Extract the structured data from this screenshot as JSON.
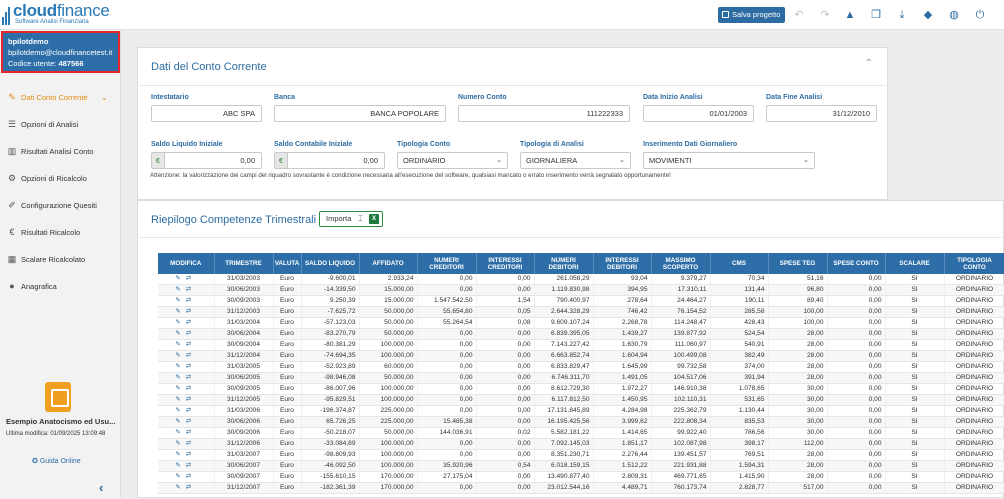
{
  "app": {
    "logo_bold": "cloud",
    "logo_light": "finance",
    "logo_sub": "Software Analisi Finanziaria",
    "save_label": "Salva progetto"
  },
  "toolbar_icons": [
    "undo-icon",
    "redo-icon",
    "warning-icon",
    "copy-icon",
    "download-icon",
    "tags-icon",
    "globe-icon",
    "power-icon"
  ],
  "user": {
    "name": "bpilotdemo",
    "email": "bpilotdemo@cloudfinancetest.it",
    "code_label": "Codice utente:",
    "code_value": "487566"
  },
  "nav": [
    {
      "label": "Dati Conto Corrente",
      "icon": "edit-icon",
      "active": true
    },
    {
      "label": "Opzioni di Analisi",
      "icon": "sliders-icon"
    },
    {
      "label": "Risultati Analisi Conto",
      "icon": "chart-icon"
    },
    {
      "label": "Opzioni di Ricalcolo",
      "icon": "gears-icon"
    },
    {
      "label": "Configurazione Quesiti",
      "icon": "pencil-icon"
    },
    {
      "label": "Risultati Ricalcolo",
      "icon": "euro-icon"
    },
    {
      "label": "Scalare Ricalcolato",
      "icon": "table-icon"
    },
    {
      "label": "Anagrafica",
      "icon": "user-icon"
    }
  ],
  "project": {
    "name": "Esempio Anatocismo ed Usu...",
    "modified": "Ultima modifica: 01/09/2025 13:09:48"
  },
  "guide_label": "Guida Online",
  "account": {
    "title": "Dati del Conto Corrente",
    "intestatario_label": "Intestatario",
    "intestatario_value": "ABC SPA",
    "banca_label": "Banca",
    "banca_value": "BANCA POPOLARE",
    "numero_label": "Numero Conto",
    "numero_value": "111222333",
    "inizio_label": "Data Inizio Analisi",
    "inizio_value": "01/01/2003",
    "fine_label": "Data Fine Analisi",
    "fine_value": "31/12/2010",
    "saldo_liq_label": "Saldo Liquido Iniziale",
    "saldo_liq_value": "0,00",
    "saldo_cont_label": "Saldo Contabile Iniziale",
    "saldo_cont_value": "0,00",
    "currency": "€",
    "tipologia_conto_label": "Tipologia Conto",
    "tipologia_conto_value": "ORDINARIO",
    "tipologia_analisi_label": "Tipologia di Analisi",
    "tipologia_analisi_value": "GIORNALIERA",
    "inserimento_label": "Inserimento Dati Giornaliero",
    "inserimento_value": "MOVIMENTI",
    "note": "Attenzione: la valorizzazione dei campi del riquadro sovrastante è condizione necessaria all'esecuzione del software, qualsiasi mancato o errato inserimento verrà segnalato opportunamente!"
  },
  "summary": {
    "title": "Riepilogo Competenze Trimestrali",
    "import_label": "Importa",
    "columns": [
      "MODIFICA",
      "TRIMESTRE",
      "VALUTA",
      "SALDO LIQUIDO",
      "AFFIDATO",
      "NUMERI CREDITORI",
      "INTERESSI CREDITORI",
      "NUMERI DEBITORI",
      "INTERESSI DEBITORI",
      "MASSIMO SCOPERTO",
      "CMS",
      "SPESE TEG",
      "SPESE CONTO",
      "SCALARE",
      "TIPOLOGIA CONTO"
    ],
    "rows": [
      [
        "31/03/2003",
        "Euro",
        "-9.600,01",
        "2.933,24",
        "0,00",
        "0,00",
        "261.058,29",
        "93,04",
        "9.379,27",
        "70,34",
        "51,16",
        "0,00",
        "SI",
        "ORDINARIO"
      ],
      [
        "30/06/2003",
        "Euro",
        "-14.339,50",
        "15.000,00",
        "0,00",
        "0,00",
        "1.119.830,98",
        "394,95",
        "17.310,11",
        "131,44",
        "96,80",
        "0,00",
        "SI",
        "ORDINARIO"
      ],
      [
        "30/09/2003",
        "Euro",
        "9.250,39",
        "15.000,00",
        "1.547.542,50",
        "1,54",
        "790.400,97",
        "278,64",
        "24.464,27",
        "190,11",
        "89,40",
        "0,00",
        "SI",
        "ORDINARIO"
      ],
      [
        "31/12/2003",
        "Euro",
        "-7.625,72",
        "50.000,00",
        "55.654,80",
        "0,05",
        "2.644.328,29",
        "746,42",
        "76.154,52",
        "285,58",
        "100,00",
        "0,00",
        "SI",
        "ORDINARIO"
      ],
      [
        "31/03/2004",
        "Euro",
        "-57.123,03",
        "50.000,00",
        "55.264,54",
        "0,08",
        "9.609.107,24",
        "2.268,78",
        "114.248,47",
        "428,43",
        "100,00",
        "0,00",
        "SI",
        "ORDINARIO"
      ],
      [
        "30/06/2004",
        "Euro",
        "-83.270,79",
        "50.000,00",
        "0,00",
        "0,00",
        "6.839.395,05",
        "1.439,27",
        "139.877,92",
        "524,54",
        "28,00",
        "0,00",
        "SI",
        "ORDINARIO"
      ],
      [
        "30/09/2004",
        "Euro",
        "-80.381,29",
        "100.000,00",
        "0,00",
        "0,00",
        "7.143.227,42",
        "1.630,79",
        "111.060,97",
        "540,91",
        "28,00",
        "0,00",
        "SI",
        "ORDINARIO"
      ],
      [
        "31/12/2004",
        "Euro",
        "-74.694,35",
        "100.000,00",
        "0,00",
        "0,00",
        "6.663.852,74",
        "1.604,94",
        "100.499,08",
        "382,49",
        "28,00",
        "0,00",
        "SI",
        "ORDINARIO"
      ],
      [
        "31/03/2005",
        "Euro",
        "-52.923,89",
        "60.000,00",
        "0,00",
        "0,00",
        "6.833.829,47",
        "1.645,99",
        "99.732,58",
        "374,00",
        "28,00",
        "0,00",
        "SI",
        "ORDINARIO"
      ],
      [
        "30/06/2005",
        "Euro",
        "-98.946,08",
        "50.000,00",
        "0,00",
        "0,00",
        "6.746.311,70",
        "1.491,05",
        "104.517,06",
        "391,94",
        "28,00",
        "0,00",
        "SI",
        "ORDINARIO"
      ],
      [
        "30/09/2005",
        "Euro",
        "-86.007,96",
        "100.000,00",
        "0,00",
        "0,00",
        "8.612.729,30",
        "1.972,27",
        "146.910,38",
        "1.078,65",
        "30,00",
        "0,00",
        "SI",
        "ORDINARIO"
      ],
      [
        "31/12/2005",
        "Euro",
        "-95.829,51",
        "100.000,00",
        "0,00",
        "0,00",
        "6.117.812,50",
        "1.450,95",
        "102.110,31",
        "531,65",
        "30,00",
        "0,00",
        "SI",
        "ORDINARIO"
      ],
      [
        "31/03/2006",
        "Euro",
        "-196.374,87",
        "225.000,00",
        "0,00",
        "0,00",
        "17.131.845,89",
        "4.284,98",
        "225.362,79",
        "1.130,44",
        "30,00",
        "0,00",
        "SI",
        "ORDINARIO"
      ],
      [
        "30/06/2006",
        "Euro",
        "65.726,25",
        "225.000,00",
        "15.485,38",
        "0,00",
        "16.195.425,56",
        "3.999,62",
        "222.808,34",
        "835,53",
        "30,00",
        "0,00",
        "SI",
        "ORDINARIO"
      ],
      [
        "30/09/2006",
        "Euro",
        "-50.218,07",
        "50.000,00",
        "144.036,91",
        "0,02",
        "5.582.181,22",
        "1.414,65",
        "99.922,40",
        "786,56",
        "30,00",
        "0,00",
        "SI",
        "ORDINARIO"
      ],
      [
        "31/12/2006",
        "Euro",
        "-33.084,89",
        "100.000,00",
        "0,00",
        "0,00",
        "7.092.145,03",
        "1.851,17",
        "102.087,98",
        "398,17",
        "112,00",
        "0,00",
        "SI",
        "ORDINARIO"
      ],
      [
        "31/03/2007",
        "Euro",
        "-98.809,93",
        "100.000,00",
        "0,00",
        "0,00",
        "8.351.230,71",
        "2.276,44",
        "139.451,57",
        "769,51",
        "28,00",
        "0,00",
        "SI",
        "ORDINARIO"
      ],
      [
        "30/06/2007",
        "Euro",
        "-46.092,50",
        "100.000,00",
        "35.920,96",
        "0,54",
        "6.018.159,15",
        "1.512,22",
        "221.931,88",
        "1.594,31",
        "28,00",
        "0,00",
        "SI",
        "ORDINARIO"
      ],
      [
        "30/09/2007",
        "Euro",
        "-155.610,15",
        "170.000,00",
        "27.175,04",
        "0,00",
        "13.490.877,40",
        "2.809,31",
        "469.771,65",
        "1.415,90",
        "28,00",
        "0,00",
        "SI",
        "ORDINARIO"
      ],
      [
        "31/12/2007",
        "Euro",
        "-182.361,39",
        "170.000,00",
        "0,00",
        "0,00",
        "23.012.544,16",
        "4.489,71",
        "760.173,74",
        "2.828,77",
        "517,00",
        "0,00",
        "SI",
        "ORDINARIO"
      ]
    ]
  }
}
